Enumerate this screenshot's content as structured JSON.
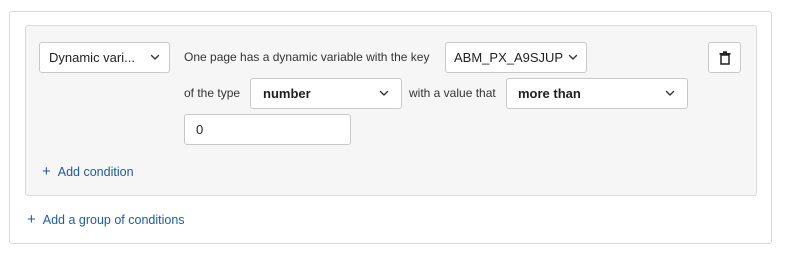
{
  "condition_group": {
    "type_select": {
      "value": "Dynamic vari...",
      "icon": "chevron-down-icon"
    },
    "sentence": {
      "prefix": "One page has a dynamic variable with the key",
      "of_the_type": "of the type",
      "with_value": "with a value that"
    },
    "key_select": {
      "value": "ABM_PX_A9SJUP",
      "icon": "chevron-down-icon"
    },
    "value_type_select": {
      "value": "number",
      "icon": "chevron-down-icon"
    },
    "operator_select": {
      "value": "more than",
      "icon": "chevron-down-icon"
    },
    "value_input": {
      "value": "0"
    },
    "delete_button": {
      "icon": "trash-icon"
    },
    "add_condition": {
      "plus": "+",
      "label": "Add condition"
    }
  },
  "add_group": {
    "plus": "+",
    "label": "Add a group of conditions"
  },
  "colors": {
    "link": "#1f5c99",
    "card_background": "#f6f6f7",
    "border": "#c9c9c9"
  }
}
